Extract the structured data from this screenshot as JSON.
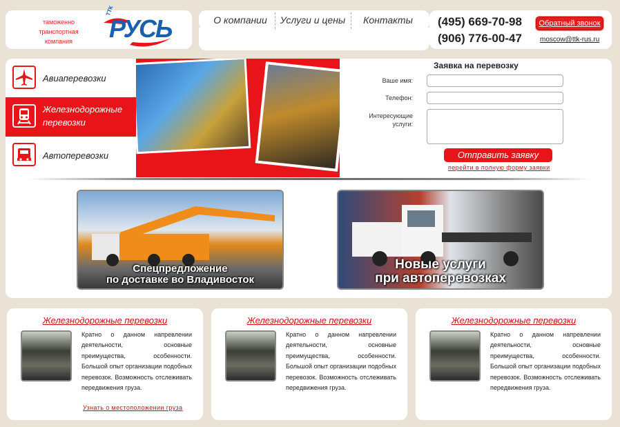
{
  "header": {
    "tagline": "таможенно транспортная компания",
    "logo_small": "ТТК",
    "logo_text": "РУСЬ"
  },
  "nav": {
    "items": [
      {
        "label": "О компании"
      },
      {
        "label": "Услуги и цены"
      },
      {
        "label": "Контакты"
      }
    ]
  },
  "contact": {
    "phone1": "(495) 669-70-98",
    "phone2": "(906) 776-00-47",
    "callback_label": "Обратный звонок",
    "email": "moscow@ttk-rus.ru"
  },
  "services": [
    {
      "label": "Авиаперевозки",
      "icon": "airplane-icon",
      "active": false
    },
    {
      "label": "Железнодорожные перевозки",
      "icon": "train-icon",
      "active": true
    },
    {
      "label": "Автоперевозки",
      "icon": "truck-icon",
      "active": false
    }
  ],
  "form": {
    "title": "Заявка на перевозку",
    "name_label": "Ваше имя:",
    "phone_label": "Телефон:",
    "services_label": "Интересующие услуги:",
    "submit_label": "Отправить заявку",
    "full_form_link": "перейти в полную форму заявки"
  },
  "promos": [
    {
      "caption_line1": "Спецпредложение",
      "caption_line2": "по доставке во Владивосток"
    },
    {
      "caption_line1": "Новые услуги",
      "caption_line2": "при автоперевозках"
    }
  ],
  "cards": [
    {
      "title": "Железнодорожные перевозки",
      "text": "Кратно о данном напревлении деятельности, основные преимущества, особенности. Большой опыт организации подобных перевозок. Возможность отслеживать передвижения груза.",
      "link": "Узнать о местоположении груза"
    },
    {
      "title": "Железнодорожные перевозки",
      "text": "Кратно о данном напревлении деятельности, основные преимущества, особенности. Большой опыт организации подобных перевозок. Возможность отслеживать передвижения груза."
    },
    {
      "title": "Железнодорожные перевозки",
      "text": "Кратно о данном напревлении деятельности, основные преимущества, особенности. Большой опыт организации подобных перевозок. Возможность отслеживать передвижения груза."
    }
  ],
  "colors": {
    "accent": "#e8141a",
    "brand_blue": "#1b5fb0",
    "background": "#e9e2d5"
  }
}
